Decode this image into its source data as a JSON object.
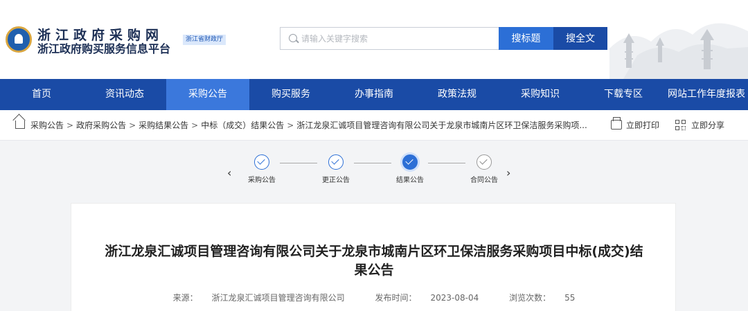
{
  "header": {
    "site_title": "浙江政府采购网",
    "site_subtitle": "浙江政府购买服务信息平台",
    "dept_badge": "浙江省财政厅",
    "search_placeholder": "请输入关键字搜索",
    "search_title_button": "搜标题",
    "search_full_button": "搜全文",
    "brand_color": "#1a4ba6"
  },
  "nav": {
    "items": [
      {
        "label": "首页"
      },
      {
        "label": "资讯动态"
      },
      {
        "label": "采购公告"
      },
      {
        "label": "购买服务"
      },
      {
        "label": "办事指南"
      },
      {
        "label": "政策法规"
      },
      {
        "label": "采购知识"
      },
      {
        "label": "下载专区"
      },
      {
        "label": "网站工作年度报表"
      }
    ],
    "active": "采购公告"
  },
  "breadcrumb": {
    "items": [
      "采购公告",
      "政府采购公告",
      "采购结果公告",
      "中标（成交）结果公告",
      "浙江龙泉汇诚项目管理咨询有限公司关于龙泉市城南片区环卫保洁服务采购项..."
    ],
    "separator": ">",
    "print_label": "立即打印",
    "share_label": "立即分享"
  },
  "steps": {
    "items": [
      {
        "label": "采购公告",
        "state": "done"
      },
      {
        "label": "更正公告",
        "state": "done"
      },
      {
        "label": "结果公告",
        "state": "current"
      },
      {
        "label": "合同公告",
        "state": "pending"
      }
    ],
    "prev_arrow": "‹",
    "next_arrow": "›"
  },
  "article": {
    "title": "浙江龙泉汇诚项目管理咨询有限公司关于龙泉市城南片区环卫保洁服务采购项目中标(成交)结果公告",
    "source_label": "来源：",
    "source_value": "浙江龙泉汇诚项目管理咨询有限公司",
    "date_label": "发布时间：",
    "date_value": "2023-08-04",
    "views_label": "浏览次数：",
    "views_value": "55"
  }
}
